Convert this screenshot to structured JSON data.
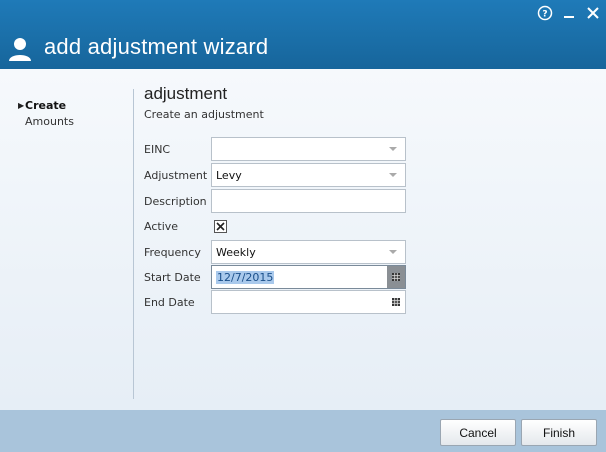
{
  "window": {
    "title": "add adjustment wizard",
    "help_icon": "help-circle-icon",
    "minimize_icon": "minimize-icon",
    "close_icon": "close-icon"
  },
  "steps": [
    {
      "label": "Create",
      "active": true
    },
    {
      "label": "Amounts",
      "active": false
    }
  ],
  "section": {
    "heading": "adjustment",
    "subheading": "Create an adjustment"
  },
  "fields": {
    "einc": {
      "label": "EINC",
      "value": ""
    },
    "adjustment": {
      "label": "Adjustment",
      "value": "Levy"
    },
    "description": {
      "label": "Description",
      "value": ""
    },
    "active": {
      "label": "Active",
      "checked": true
    },
    "frequency": {
      "label": "Frequency",
      "value": "Weekly"
    },
    "start_date": {
      "label": "Start Date",
      "value": "12/7/2015"
    },
    "end_date": {
      "label": "End Date",
      "value": ""
    }
  },
  "buttons": {
    "cancel": "Cancel",
    "finish": "Finish"
  },
  "colors": {
    "titlebar": "#1a6ea7",
    "footer": "#a9c4db",
    "selection": "#a9c9ec"
  }
}
